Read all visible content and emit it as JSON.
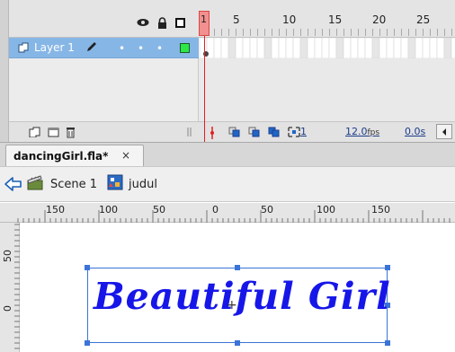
{
  "timeline": {
    "header_icons": [
      "eye-icon",
      "lock-icon",
      "outline-icon"
    ],
    "frame_numbers": [
      "1",
      "5",
      "10",
      "15",
      "20",
      "25"
    ],
    "current_frame": "1",
    "layer": {
      "name": "Layer 1",
      "selected_color": "#86b6e6",
      "outline_color": "#2ee847"
    },
    "footer": {
      "frame_readout": "1",
      "fps_value": "12.0",
      "fps_unit": "fps",
      "time_value": "0.0s"
    }
  },
  "document_tab": {
    "label": "dancingGirl.fla*",
    "close_glyph": "×"
  },
  "edit_bar": {
    "scene_label": "Scene 1",
    "symbol_label": "judul"
  },
  "rulers": {
    "top_labels": [
      "150",
      "100",
      "50",
      "0",
      "50",
      "100",
      "150"
    ],
    "side_labels": [
      "50",
      "0"
    ]
  },
  "stage": {
    "text": "Beautiful Girl",
    "text_color": "#1616e8",
    "selection_color": "#3b74d8"
  }
}
